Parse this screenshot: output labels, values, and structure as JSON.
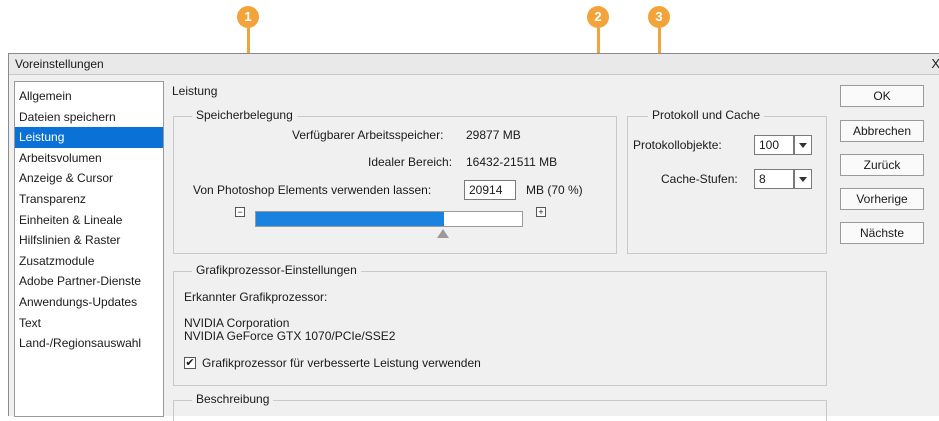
{
  "dialog": {
    "title": "Voreinstellungen",
    "close_glyph": "X"
  },
  "callouts": [
    "1",
    "2",
    "3"
  ],
  "sidebar": {
    "items": [
      {
        "label": "Allgemein"
      },
      {
        "label": "Dateien speichern"
      },
      {
        "label": "Leistung"
      },
      {
        "label": "Arbeitsvolumen"
      },
      {
        "label": "Anzeige & Cursor"
      },
      {
        "label": "Transparenz"
      },
      {
        "label": "Einheiten & Lineale"
      },
      {
        "label": "Hilfslinien & Raster"
      },
      {
        "label": "Zusatzmodule"
      },
      {
        "label": "Adobe Partner-Dienste"
      },
      {
        "label": "Anwendungs-Updates"
      },
      {
        "label": "Text"
      },
      {
        "label": "Land-/Regionsauswahl"
      }
    ],
    "selected": "Leistung"
  },
  "main": {
    "title": "Leistung",
    "memory": {
      "legend": "Speicherbelegung",
      "available_label": "Verfügbarer Arbeitsspeicher:",
      "available_value": "29877 MB",
      "ideal_label": "Idealer Bereich:",
      "ideal_value": "16432-21511 MB",
      "use_label": "Von Photoshop Elements verwenden lassen:",
      "use_value": "20914",
      "use_unit": "MB (70 %)",
      "slider_minus": "−",
      "slider_plus": "+",
      "slider_fraction": 0.7
    },
    "cache": {
      "legend": "Protokoll und Cache",
      "history_label": "Protokollobjekte:",
      "history_value": "100",
      "levels_label": "Cache-Stufen:",
      "levels_value": "8"
    },
    "gpu": {
      "legend": "Grafikprozessor-Einstellungen",
      "detected_label": "Erkannter Grafikprozessor:",
      "vendor": "NVIDIA Corporation",
      "model": "NVIDIA GeForce GTX 1070/PCIe/SSE2",
      "checkbox_label": "Grafikprozessor für verbesserte Leistung verwenden",
      "checkbox_checked": true,
      "check_glyph": "✔"
    },
    "description": {
      "legend": "Beschreibung"
    }
  },
  "buttons": {
    "ok": "OK",
    "cancel": "Abbrechen",
    "back": "Zurück",
    "previous": "Vorherige",
    "next": "Nächste"
  },
  "colors": {
    "accent": "#f2a33a",
    "selection": "#0a72d6",
    "slider_fill": "#1a83e0"
  }
}
